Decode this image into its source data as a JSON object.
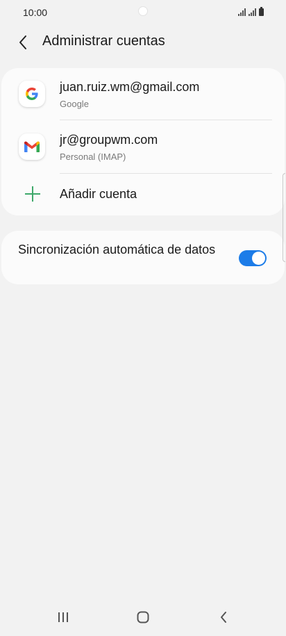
{
  "status_bar": {
    "time": "10:00"
  },
  "header": {
    "title": "Administrar cuentas",
    "back_icon": "chevron-left-icon"
  },
  "accounts": [
    {
      "email": "juan.ruiz.wm@gmail.com",
      "type": "Google",
      "icon": "google-icon"
    },
    {
      "email": "jr@groupwm.com",
      "type": "Personal (IMAP)",
      "icon": "gmail-icon"
    }
  ],
  "add_account": {
    "label": "Añadir cuenta",
    "icon": "plus-icon",
    "color": "#3ea86a"
  },
  "sync": {
    "label": "Sincronización automática de datos",
    "enabled": true,
    "color": "#1c7ce8"
  },
  "nav_bar": {
    "icons": [
      "recent-apps-icon",
      "home-icon",
      "back-icon"
    ]
  }
}
